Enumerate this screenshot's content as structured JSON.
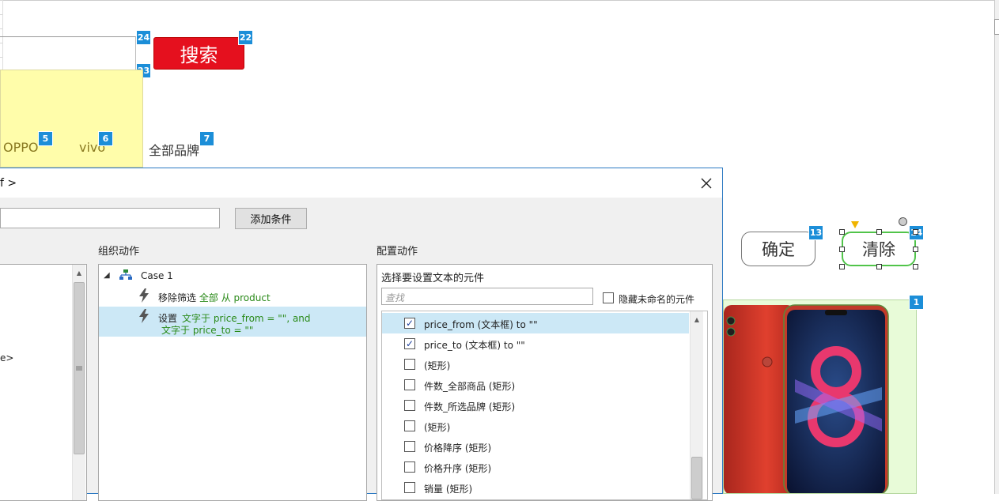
{
  "canvas": {
    "search_button_label": "搜索",
    "brands": [
      "OPPO",
      "vivo",
      "全部品牌"
    ],
    "confirm_label": "确定",
    "clear_label": "清除",
    "badges": {
      "b24": "24",
      "b22": "22",
      "b23": "23",
      "b5": "5",
      "b6": "6",
      "b7": "7",
      "b13": "13",
      "b14": "14",
      "b1": "1"
    },
    "colors": {
      "search_red": "#e5101e",
      "badge_blue": "#1c8ed8",
      "selection_green": "#51c44a",
      "yellow_panel": "#fffdaa",
      "product_panel": "#e8fbd8"
    }
  },
  "dialog": {
    "title_fragment": "f >",
    "add_condition_label": "添加条件",
    "organize_label": "组织动作",
    "configure_label": "配置动作",
    "left_item_fragment": "e>",
    "tree": {
      "case": "Case 1",
      "action1": {
        "verb": "移除筛选",
        "arg1": "全部",
        "arg2": "从 product"
      },
      "action2": {
        "verb": "设置",
        "line1": "文字于 price_from = \"\", and",
        "line2": "文字于 price_to = \"\""
      }
    },
    "config": {
      "heading": "选择要设置文本的元件",
      "find_placeholder": "查找",
      "hide_unnamed_label": "隐藏未命名的元件",
      "widgets": [
        {
          "label": "price_from (文本框) to \"\"",
          "checked": true,
          "selected": true
        },
        {
          "label": "price_to (文本框) to \"\"",
          "checked": true,
          "selected": false
        },
        {
          "label": "(矩形)",
          "checked": false,
          "selected": false
        },
        {
          "label": "件数_全部商品 (矩形)",
          "checked": false,
          "selected": false
        },
        {
          "label": "件数_所选品牌 (矩形)",
          "checked": false,
          "selected": false
        },
        {
          "label": "(矩形)",
          "checked": false,
          "selected": false
        },
        {
          "label": "价格降序 (矩形)",
          "checked": false,
          "selected": false
        },
        {
          "label": "价格升序 (矩形)",
          "checked": false,
          "selected": false
        },
        {
          "label": "销量 (矩形)",
          "checked": false,
          "selected": false
        }
      ]
    }
  }
}
